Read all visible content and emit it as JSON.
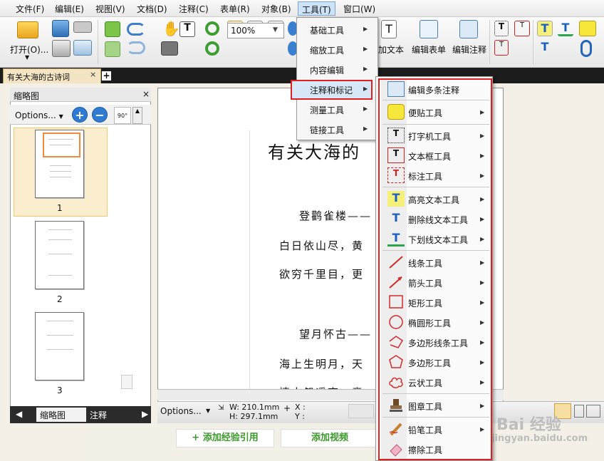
{
  "menubar": {
    "items": [
      "文件(F)",
      "编辑(E)",
      "视图(V)",
      "文档(D)",
      "注释(C)",
      "表单(R)",
      "对象(B)",
      "工具(T)",
      "窗口(W)"
    ]
  },
  "toolbar": {
    "open_label": "打开(O)...",
    "zoom_value": "100%",
    "add_text_label": "加文本",
    "edit_form_label": "编辑表单",
    "edit_comment_label": "编辑注释"
  },
  "tabs": {
    "doc_tab": "有关大海的古诗词",
    "close": "×",
    "add": "+"
  },
  "left_panel": {
    "title": "缩略图",
    "close": "×",
    "options": "Options...",
    "rotate": "90°",
    "pages": [
      "1",
      "2",
      "3"
    ],
    "bottom_tabs": [
      "缩略图",
      "注释"
    ]
  },
  "document": {
    "title": "有关大海的",
    "lines": [
      "登鹳雀楼——",
      "白日依山尽，黄",
      "欲穷千里目，更",
      "望月怀古——",
      "海上生明月，天",
      "情人怨遥夜，竟"
    ]
  },
  "statusbar": {
    "options": "Options...",
    "width": "W: 210.1mm",
    "height": "H: 297.1mm",
    "x": "X :",
    "y": "Y :"
  },
  "baidu": {
    "add_reference": "+ 添加经验引用",
    "add_video": "添加视频",
    "watermark_logo": "Bai 经验",
    "watermark_url": "jingyan.baidu.com"
  },
  "tools_menu": {
    "items": [
      "基础工具",
      "缩放工具",
      "内容编辑",
      "注释和标记",
      "测量工具",
      "链接工具"
    ]
  },
  "annot_menu": {
    "items": [
      "编辑多条注释",
      "便贴工具",
      "打字机工具",
      "文本框工具",
      "标注工具",
      "高亮文本工具",
      "删除线文本工具",
      "下划线文本工具",
      "线条工具",
      "箭头工具",
      "矩形工具",
      "椭圆形工具",
      "多边形线条工具",
      "多边形工具",
      "云状工具",
      "图章工具",
      "铅笔工具",
      "擦除工具"
    ]
  },
  "colors": {
    "highlight_border": "#e02020",
    "tab_active": "#f3e4c4",
    "thumb_selected_border": "#f08a3c"
  }
}
